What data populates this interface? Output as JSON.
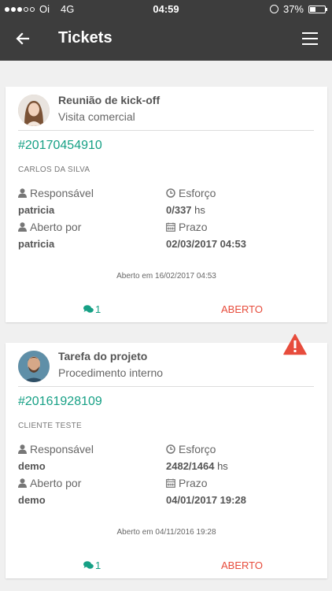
{
  "statusbar": {
    "carrier": "Oi",
    "network": "4G",
    "time": "04:59",
    "battery": "37%",
    "signal_bars": 3,
    "signal_max": 5,
    "battery_level": 0.37
  },
  "appbar": {
    "title": "Tickets",
    "back_icon": "arrow-left-icon",
    "menu_icon": "hamburger-menu-icon"
  },
  "tickets": [
    {
      "title": "Reunião de kick-off",
      "subtitle": "Visita comercial",
      "id": "#20170454910",
      "client": "CARLOS DA SILVA",
      "responsible_label": "Responsável",
      "responsible": "patricia",
      "opened_by_label": "Aberto por",
      "opened_by": "patricia",
      "effort_label": "Esforço",
      "effort": "0/337",
      "effort_unit": "hs",
      "deadline_label": "Prazo",
      "deadline": "02/03/2017 04:53",
      "opened_at": "Aberto em 16/02/2017 04:53",
      "comments": "1",
      "status": "ABERTO",
      "warning": false
    },
    {
      "title": "Tarefa do projeto",
      "subtitle": "Procedimento interno",
      "id": "#20161928109",
      "client": "CLIENTE TESTE",
      "responsible_label": "Responsável",
      "responsible": "demo",
      "opened_by_label": "Aberto por",
      "opened_by": "demo",
      "effort_label": "Esforço",
      "effort": "2482/1464",
      "effort_unit": "hs",
      "deadline_label": "Prazo",
      "deadline": "04/01/2017 19:28",
      "opened_at": "Aberto em 04/11/2016 19:28",
      "comments": "1",
      "status": "ABERTO",
      "warning": true
    }
  ],
  "colors": {
    "appbar": "#3d3d3d",
    "accent": "#16a085",
    "status_open": "#e74c3c",
    "warning": "#e74c3c"
  }
}
